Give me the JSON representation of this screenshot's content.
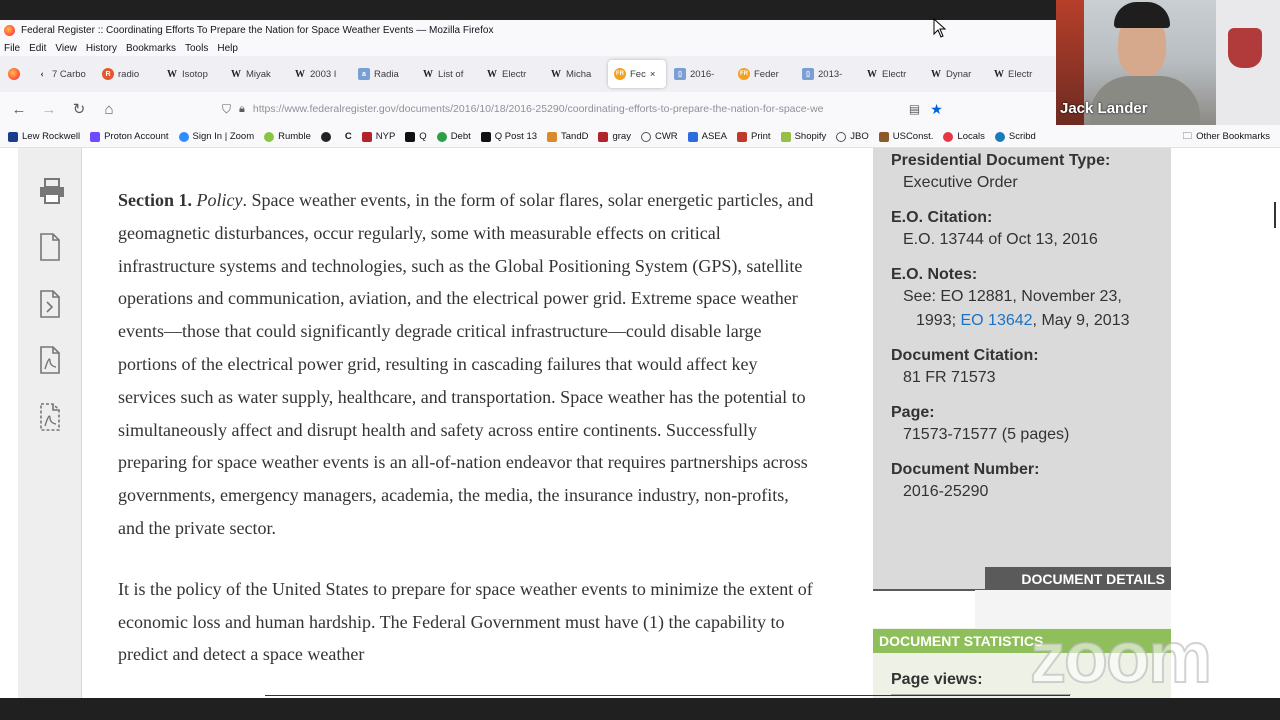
{
  "window": {
    "title": "Federal Register :: Coordinating Efforts To Prepare the Nation for Space Weather Events — Mozilla Firefox"
  },
  "menu": [
    "File",
    "Edit",
    "View",
    "History",
    "Bookmarks",
    "Tools",
    "Help"
  ],
  "tabs": [
    {
      "label": "7 Carbo",
      "icon": "back-chevron"
    },
    {
      "label": "radio",
      "icon": "R"
    },
    {
      "label": "Isotop",
      "icon": "W"
    },
    {
      "label": "Miyak",
      "icon": "W"
    },
    {
      "label": "2003 I",
      "icon": "W"
    },
    {
      "label": "Radia",
      "icon": "ARC"
    },
    {
      "label": "List of",
      "icon": "W"
    },
    {
      "label": "Electr",
      "icon": "W"
    },
    {
      "label": "Micha",
      "icon": "W"
    },
    {
      "label": "Fec",
      "icon": "FR",
      "active": true
    },
    {
      "label": "2016-",
      "icon": "doc"
    },
    {
      "label": "Feder",
      "icon": "FR"
    },
    {
      "label": "2013-",
      "icon": "doc"
    },
    {
      "label": "Electr",
      "icon": "W"
    },
    {
      "label": "Dynar",
      "icon": "W"
    },
    {
      "label": "Electr",
      "icon": "W"
    }
  ],
  "address_bar": {
    "url": "https://www.federalregister.gov/documents/2016/10/18/2016-25290/coordinating-efforts-to-prepare-the-nation-for-space-we"
  },
  "bookmarks": [
    {
      "label": "Lew Rockwell",
      "color": "#1a3d8f"
    },
    {
      "label": "Proton Account",
      "color": "#6d4aff"
    },
    {
      "label": "Sign In | Zoom",
      "color": "#2d8cff"
    },
    {
      "label": "Rumble",
      "color": "#85c742"
    },
    {
      "label": "",
      "color": "#222222"
    },
    {
      "label": "C",
      "color": "#ffffff"
    },
    {
      "label": "NYP",
      "color": "#b0242a"
    },
    {
      "label": "Q",
      "color": "#111111"
    },
    {
      "label": "Debt",
      "color": "#2c9f45"
    },
    {
      "label": "Q Post 13",
      "color": "#111111"
    },
    {
      "label": "TandD",
      "color": "#d98b2b"
    },
    {
      "label": "gray",
      "color": "#b0242a"
    },
    {
      "label": "CWR",
      "color": "#555555"
    },
    {
      "label": "ASEA",
      "color": "#2d6cdf"
    },
    {
      "label": "Print",
      "color": "#c0392b"
    },
    {
      "label": "Shopify",
      "color": "#95bf47"
    },
    {
      "label": "JBO",
      "color": "#555555"
    },
    {
      "label": "USConst.",
      "color": "#8b5a2b"
    },
    {
      "label": "Locals",
      "color": "#e63946"
    },
    {
      "label": "Scribd",
      "color": "#1a7bba"
    }
  ],
  "other_bookmarks": "Other Bookmarks",
  "article": {
    "section_label": "Section 1.",
    "policy_label": "Policy",
    "para1_rest": ". Space weather events, in the form of solar flares, solar energetic particles, and geomagnetic disturbances, occur regularly, some with measurable effects on critical infrastructure systems and technologies, such as the Global Positioning System (GPS), satellite operations and communication, aviation, and the electrical power grid. Extreme space weather events—those that could significantly degrade critical infrastructure—could disable large portions of the electrical power grid, resulting in cascading failures that would affect key services such as water supply, healthcare, and transportation. Space weather has the potential to simultaneously affect and disrupt health and safety across entire continents. Successfully preparing for space weather events is an all-of-nation endeavor that requires partnerships across governments, emergency managers, academia, the media, the insurance industry, non-profits, and the private sector.",
    "para2": "It is the policy of the United States to prepare for space weather events to minimize the extent of economic loss and human hardship. The Federal Government must have (1) the capability to predict and detect a space weather"
  },
  "sidebar": {
    "doc_type_label": "Presidential Document Type:",
    "doc_type_value": "Executive Order",
    "eo_citation_label": "E.O. Citation:",
    "eo_citation_value": "E.O. 13744 of Oct 13, 2016",
    "eo_notes_label": "E.O. Notes:",
    "eo_notes_prefix": "See: EO 12881, November 23, 1993; ",
    "eo_notes_link": "EO 13642",
    "eo_notes_suffix": ", May 9, 2013",
    "doc_citation_label": "Document Citation:",
    "doc_citation_value": "81 FR 71573",
    "page_label": "Page:",
    "page_value": "71573-71577 (5 pages)",
    "doc_number_label": "Document Number:",
    "doc_number_value": "2016-25290",
    "details_button": "DOCUMENT DETAILS",
    "stats_header": "DOCUMENT STATISTICS",
    "page_views_label": "Page views:"
  },
  "webcam": {
    "name": "Jack Lander"
  },
  "watermark": "zoom"
}
